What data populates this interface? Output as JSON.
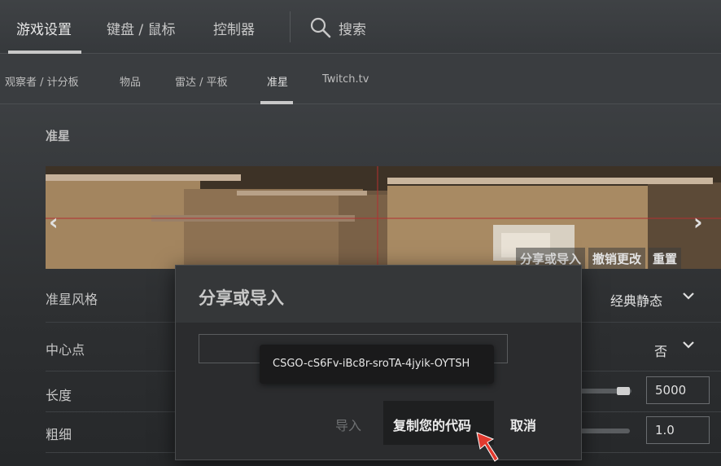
{
  "top_tabs": [
    {
      "label": "游戏设置"
    },
    {
      "label": "键盘 / 鼠标"
    },
    {
      "label": "控制器"
    }
  ],
  "search": {
    "label": "搜索",
    "icon": "search-icon"
  },
  "sub_tabs": [
    {
      "label": "观察者 / 计分板"
    },
    {
      "label": "物品"
    },
    {
      "label": "雷达 / 平板"
    },
    {
      "label": "准星"
    },
    {
      "label": "Twitch.tv"
    }
  ],
  "section": {
    "title": "准星"
  },
  "preview": {
    "share_label": "分享或导入",
    "undo_label": "撤销更改",
    "reset_label": "重置"
  },
  "settings": [
    {
      "label": "准星风格",
      "value": "经典静态"
    },
    {
      "label": "中心点",
      "value": "否"
    },
    {
      "label": "长度",
      "value": "5000"
    },
    {
      "label": "粗细",
      "value": "1.0"
    }
  ],
  "modal": {
    "title": "分享或导入",
    "code": "CSGO-cS6Fv-iBc8r-sroTA-4jyik-OYTSH",
    "import_label": "导入",
    "copy_label": "复制您的代码",
    "cancel_label": "取消"
  },
  "colors": {
    "accent_cursor": "#e23a2f",
    "crosshair": "#b23030"
  }
}
